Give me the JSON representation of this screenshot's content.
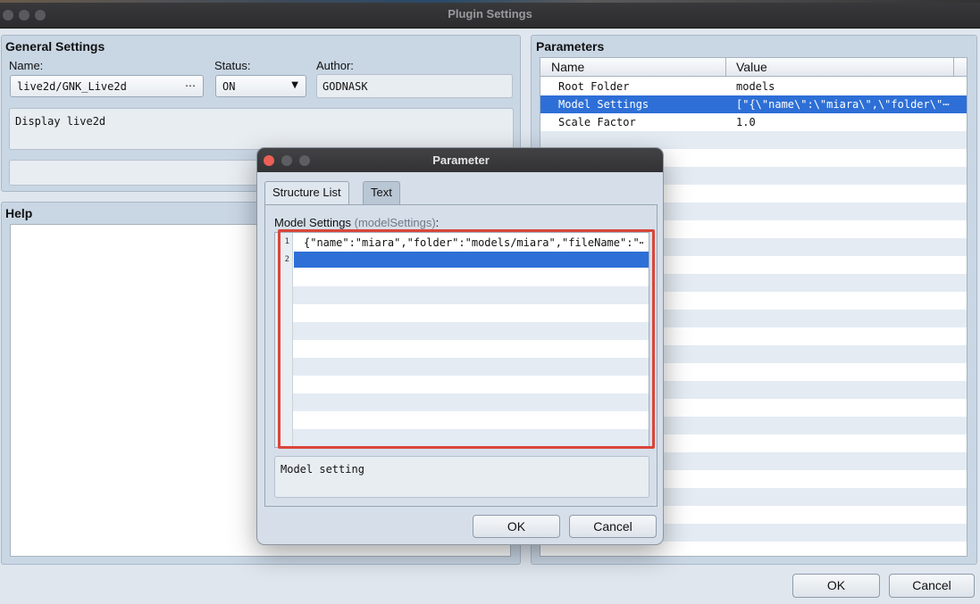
{
  "window": {
    "title": "Plugin Settings"
  },
  "general": {
    "title": "General Settings",
    "name_label": "Name:",
    "name_value": "live2d/GNK_Live2d",
    "name_more": "⋯",
    "status_label": "Status:",
    "status_value": "ON",
    "status_arrow": "▼",
    "author_label": "Author:",
    "author_value": "GODNASK",
    "description": "Display live2d",
    "note": ""
  },
  "help": {
    "title": "Help",
    "content": ""
  },
  "parameters": {
    "title": "Parameters",
    "columns": [
      "Name",
      "Value"
    ],
    "rows": [
      {
        "name": "Root Folder",
        "value": "models"
      },
      {
        "name": "Model Settings",
        "value": "[\"{\\\"name\\\":\\\"miara\\\",\\\"folder\\\"⋯"
      },
      {
        "name": "Scale Factor",
        "value": "1.0"
      }
    ],
    "selected_row": 1
  },
  "main_buttons": {
    "ok": "OK",
    "cancel": "Cancel"
  },
  "dialog": {
    "title": "Parameter",
    "tabs": [
      "Structure List",
      "Text"
    ],
    "active_tab": 0,
    "field_label": "Model Settings",
    "field_key": "(modelSettings)",
    "field_colon": ":",
    "lines": [
      {
        "num": "1",
        "text": "{\"name\":\"miara\",\"folder\":\"models/miara\",\"fileName\":\"⋯"
      },
      {
        "num": "2",
        "text": ""
      }
    ],
    "selected_line": 2,
    "description": "Model setting",
    "ok": "OK",
    "cancel": "Cancel"
  },
  "colors": {
    "selection": "#2d6fd6",
    "highlight_frame": "#d9463a",
    "close_button": "#ec5f56"
  }
}
